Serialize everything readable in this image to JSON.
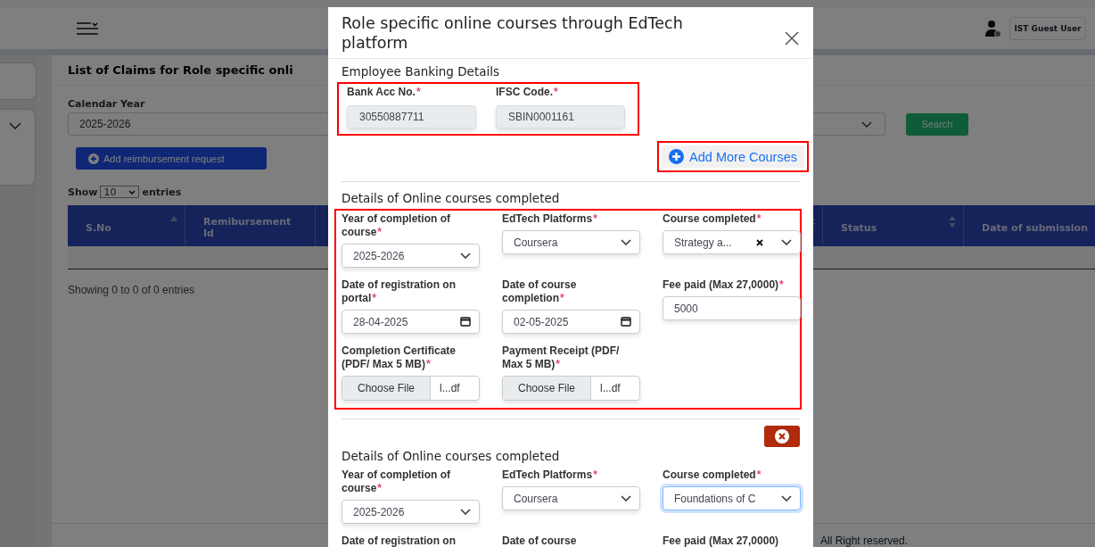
{
  "background": {
    "user_button": "IST Guest User",
    "page_title": "List of Claims for Role specific onli",
    "filter": {
      "label": "Calendar Year",
      "value": "2025-2026"
    },
    "search_button": "Search",
    "add_button": "Add reimbursement request",
    "entries": {
      "before": "Show",
      "value": "10",
      "after": "entries"
    },
    "table": {
      "columns": [
        {
          "label": "S.No",
          "kind": "ascending"
        },
        {
          "label": "Remibursement Id",
          "kind": "plain"
        },
        {
          "kind": "sortable"
        },
        {
          "label": "Status",
          "kind": "sortable"
        },
        {
          "label": "Date of submission",
          "kind": "plain"
        }
      ]
    },
    "info": "Showing 0 to 0 of 0 entries",
    "footer": "All Right reserved."
  },
  "modal": {
    "title": "Role specific online courses through EdTech platform",
    "banking": {
      "heading": "Employee Banking Details",
      "highlighted": true,
      "fields": [
        {
          "label": "Bank Acc No.",
          "mark": "*",
          "value": "30550887711"
        },
        {
          "label": "IFSC Code.",
          "mark": "*",
          "value": "SBIN0001161"
        }
      ]
    },
    "add_more": {
      "label": "Add More Courses",
      "highlighted": true
    },
    "sections": [
      {
        "heading": "Details of Online courses completed",
        "highlighted": true,
        "removable": false,
        "fields": [
          {
            "kind": "select",
            "label": "Year of completion of course",
            "mark": "*",
            "value": "2025-2026",
            "clearable": false,
            "focused": false
          },
          {
            "kind": "select",
            "label": "EdTech Platforms",
            "mark": "*",
            "value": "Coursera",
            "clearable": false,
            "focused": false
          },
          {
            "kind": "select",
            "label": "Course completed",
            "mark": "*",
            "value": "Strategy a...",
            "clearable": true,
            "focused": false
          },
          {
            "kind": "date",
            "label": "Date of registration on portal",
            "mark": "*",
            "value": "28-04-2025"
          },
          {
            "kind": "date",
            "label": "Date of course completion",
            "mark": "*",
            "value": "02-05-2025"
          },
          {
            "kind": "text",
            "label": "Fee paid (Max 27,0000)",
            "mark": "*",
            "value": "5000"
          },
          {
            "kind": "file",
            "label": "Completion Certificate (PDF/ Max 5 MB)",
            "mark": "*",
            "button": "Choose File",
            "file": "l...df"
          },
          {
            "kind": "file",
            "label": "Payment Receipt (PDF/ Max 5 MB)",
            "mark": "*",
            "button": "Choose File",
            "file": "l...df"
          }
        ]
      },
      {
        "heading": "Details of Online courses completed",
        "highlighted": false,
        "removable": true,
        "fields": [
          {
            "kind": "select",
            "label": "Year of completion of course",
            "mark": "*",
            "value": "2025-2026",
            "clearable": false,
            "focused": false
          },
          {
            "kind": "select",
            "label": "EdTech Platforms",
            "mark": "*",
            "value": "Coursera",
            "clearable": false,
            "focused": false
          },
          {
            "kind": "select",
            "label": "Course completed",
            "mark": "*",
            "value": "Foundations of C",
            "clearable": false,
            "focused": true
          },
          {
            "kind": "date",
            "label": "Date of registration on"
          },
          {
            "kind": "date",
            "label": "Date of course"
          },
          {
            "kind": "text",
            "label": "Fee paid (Max 27,0000)"
          }
        ]
      }
    ]
  }
}
